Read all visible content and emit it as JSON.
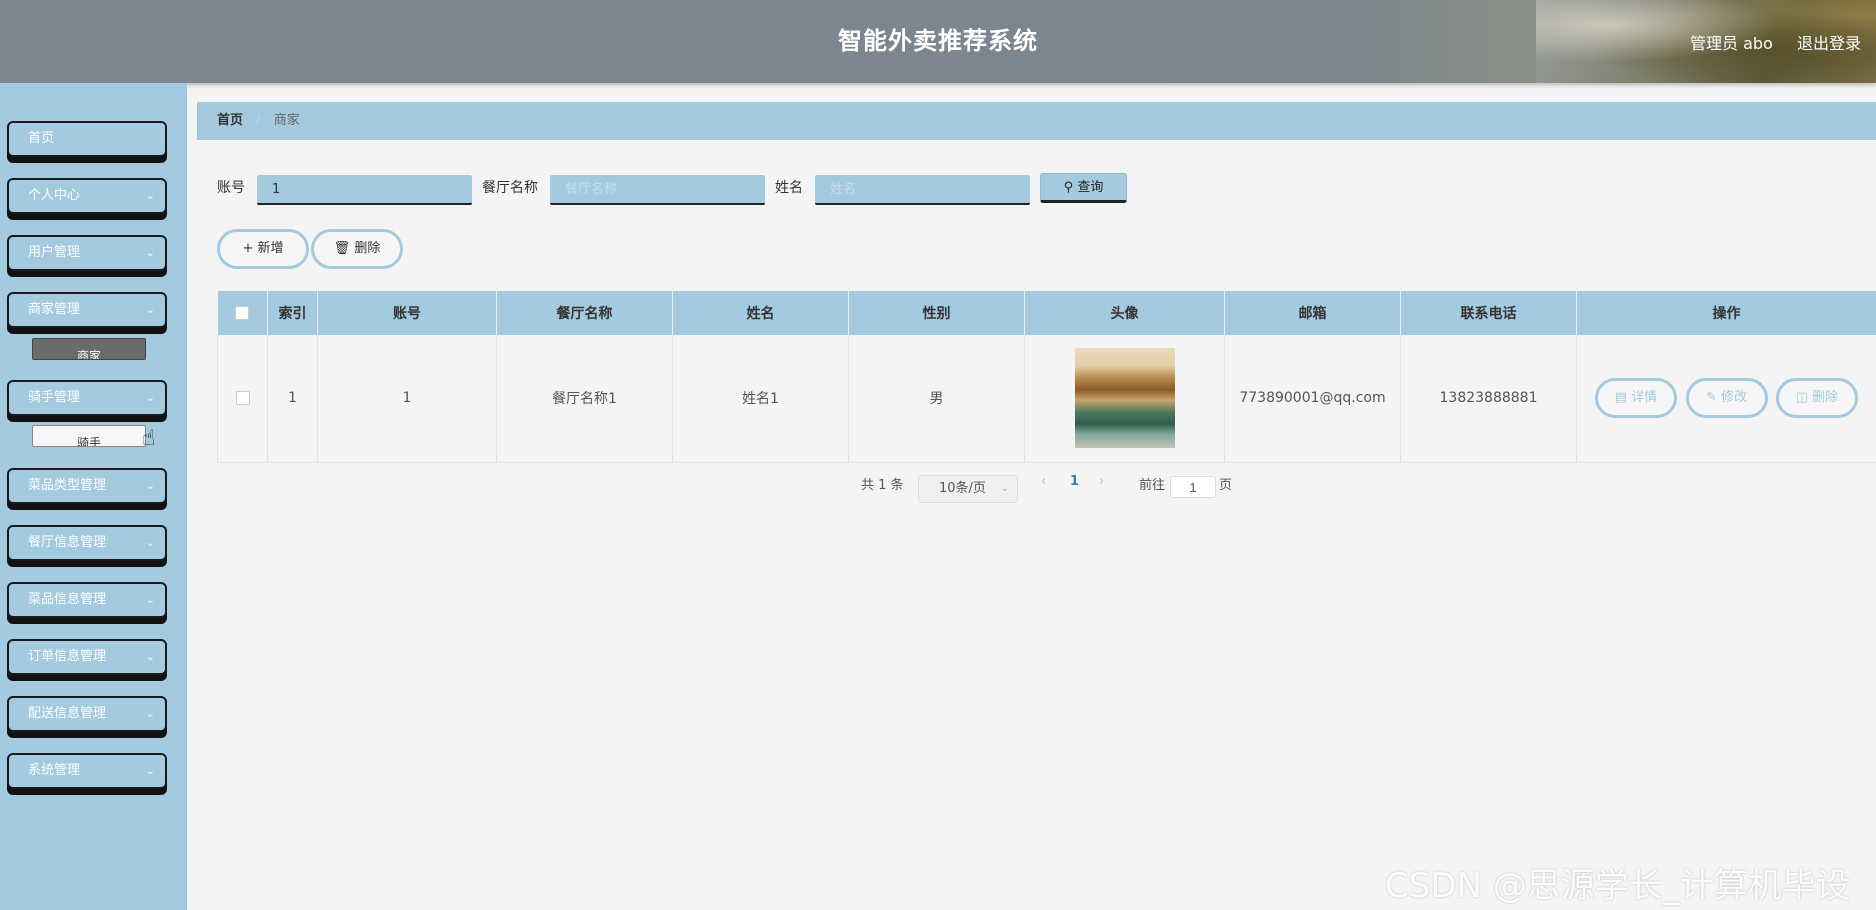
{
  "header": {
    "title": "智能外卖推荐系统",
    "user_label": "管理员 abo",
    "logout": "退出登录"
  },
  "sidebar": {
    "items": [
      {
        "label": "首页",
        "has_children": false
      },
      {
        "label": "个人中心",
        "has_children": true
      },
      {
        "label": "用户管理",
        "has_children": true
      },
      {
        "label": "商家管理",
        "has_children": true
      },
      {
        "label": "骑手管理",
        "has_children": true
      },
      {
        "label": "菜品类型管理",
        "has_children": true
      },
      {
        "label": "餐厅信息管理",
        "has_children": true
      },
      {
        "label": "菜品信息管理",
        "has_children": true
      },
      {
        "label": "订单信息管理",
        "has_children": true
      },
      {
        "label": "配送信息管理",
        "has_children": true
      },
      {
        "label": "系统管理",
        "has_children": true
      }
    ],
    "sub_merchant": "商家",
    "sub_rider": "骑手",
    "chevron_icon": "chevron-down-icon"
  },
  "breadcrumb": {
    "home": "首页",
    "separator": "/",
    "current": "商家"
  },
  "search": {
    "account_label": "账号",
    "account_value": "1",
    "restaurant_label": "餐厅名称",
    "restaurant_placeholder": "餐厅名称",
    "name_label": "姓名",
    "name_placeholder": "姓名",
    "query_button": "查询"
  },
  "actions": {
    "add": "新增",
    "delete": "删除"
  },
  "table": {
    "columns": [
      "索引",
      "账号",
      "餐厅名称",
      "姓名",
      "性别",
      "头像",
      "邮箱",
      "联系电话",
      "操作"
    ],
    "rows": [
      {
        "index": "1",
        "account": "1",
        "restaurant": "餐厅名称1",
        "name": "姓名1",
        "gender": "男",
        "email": "773890001@qq.com",
        "phone": "13823888881"
      }
    ],
    "row_actions": {
      "detail": "详情",
      "edit": "修改",
      "delete": "删除"
    }
  },
  "pagination": {
    "total": "共 1 条",
    "page_size": "10条/页",
    "current_page": "1",
    "goto_label": "前往",
    "goto_value": "1",
    "page_suffix": "页"
  },
  "watermark": "CSDN @思源学长_计算机毕设",
  "colors": {
    "accent": "#a3cade",
    "header": "#7f8890",
    "page_bg": "#f4f4f4",
    "active_page": "#2a8a9a"
  }
}
